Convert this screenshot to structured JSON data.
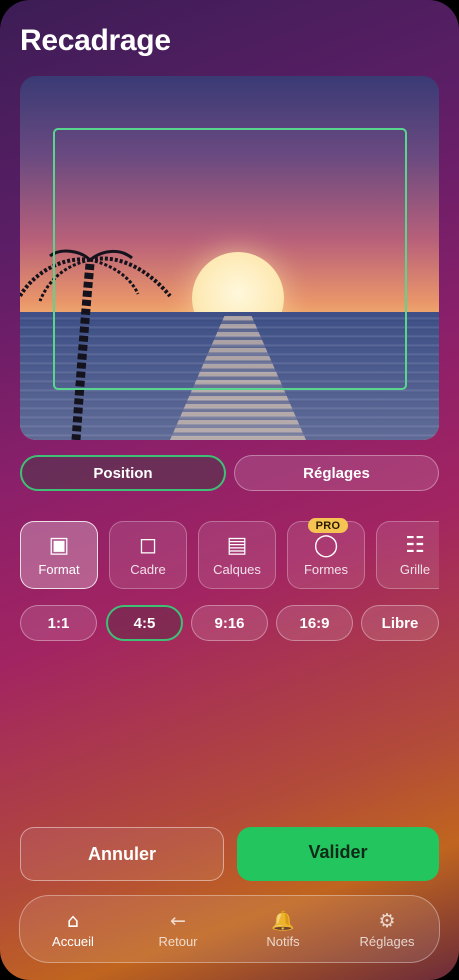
{
  "title": "Recadrage",
  "segments": {
    "position": "Position",
    "reglages": "Réglages"
  },
  "tools": [
    {
      "label": "Format",
      "icon": "square-filled-icon",
      "glyph": "▣"
    },
    {
      "label": "Cadre",
      "icon": "square-outline-icon",
      "glyph": "◻"
    },
    {
      "label": "Calques",
      "icon": "layers-icon",
      "glyph": "▤"
    },
    {
      "label": "Formes",
      "icon": "circle-icon",
      "glyph": "◯",
      "badge": "PRO"
    },
    {
      "label": "Grille",
      "icon": "grid-icon",
      "glyph": "☷"
    }
  ],
  "ratios": [
    "1:1",
    "4:5",
    "9:16",
    "16:9",
    "Libre"
  ],
  "selected_ratio": "4:5",
  "actions": {
    "cancel": "Annuler",
    "confirm": "Valider"
  },
  "nav": [
    {
      "label": "Accueil",
      "icon": "home-icon",
      "glyph": "⌂"
    },
    {
      "label": "Retour",
      "icon": "back-arrow-icon",
      "glyph": "←"
    },
    {
      "label": "Notifs",
      "icon": "bell-icon",
      "glyph": "🔔"
    },
    {
      "label": "Réglages",
      "icon": "gear-icon",
      "glyph": "⚙"
    }
  ],
  "colors": {
    "accent": "#22c55e",
    "crop_frame": "#58d68d",
    "pro_badge": "#f6c453"
  }
}
